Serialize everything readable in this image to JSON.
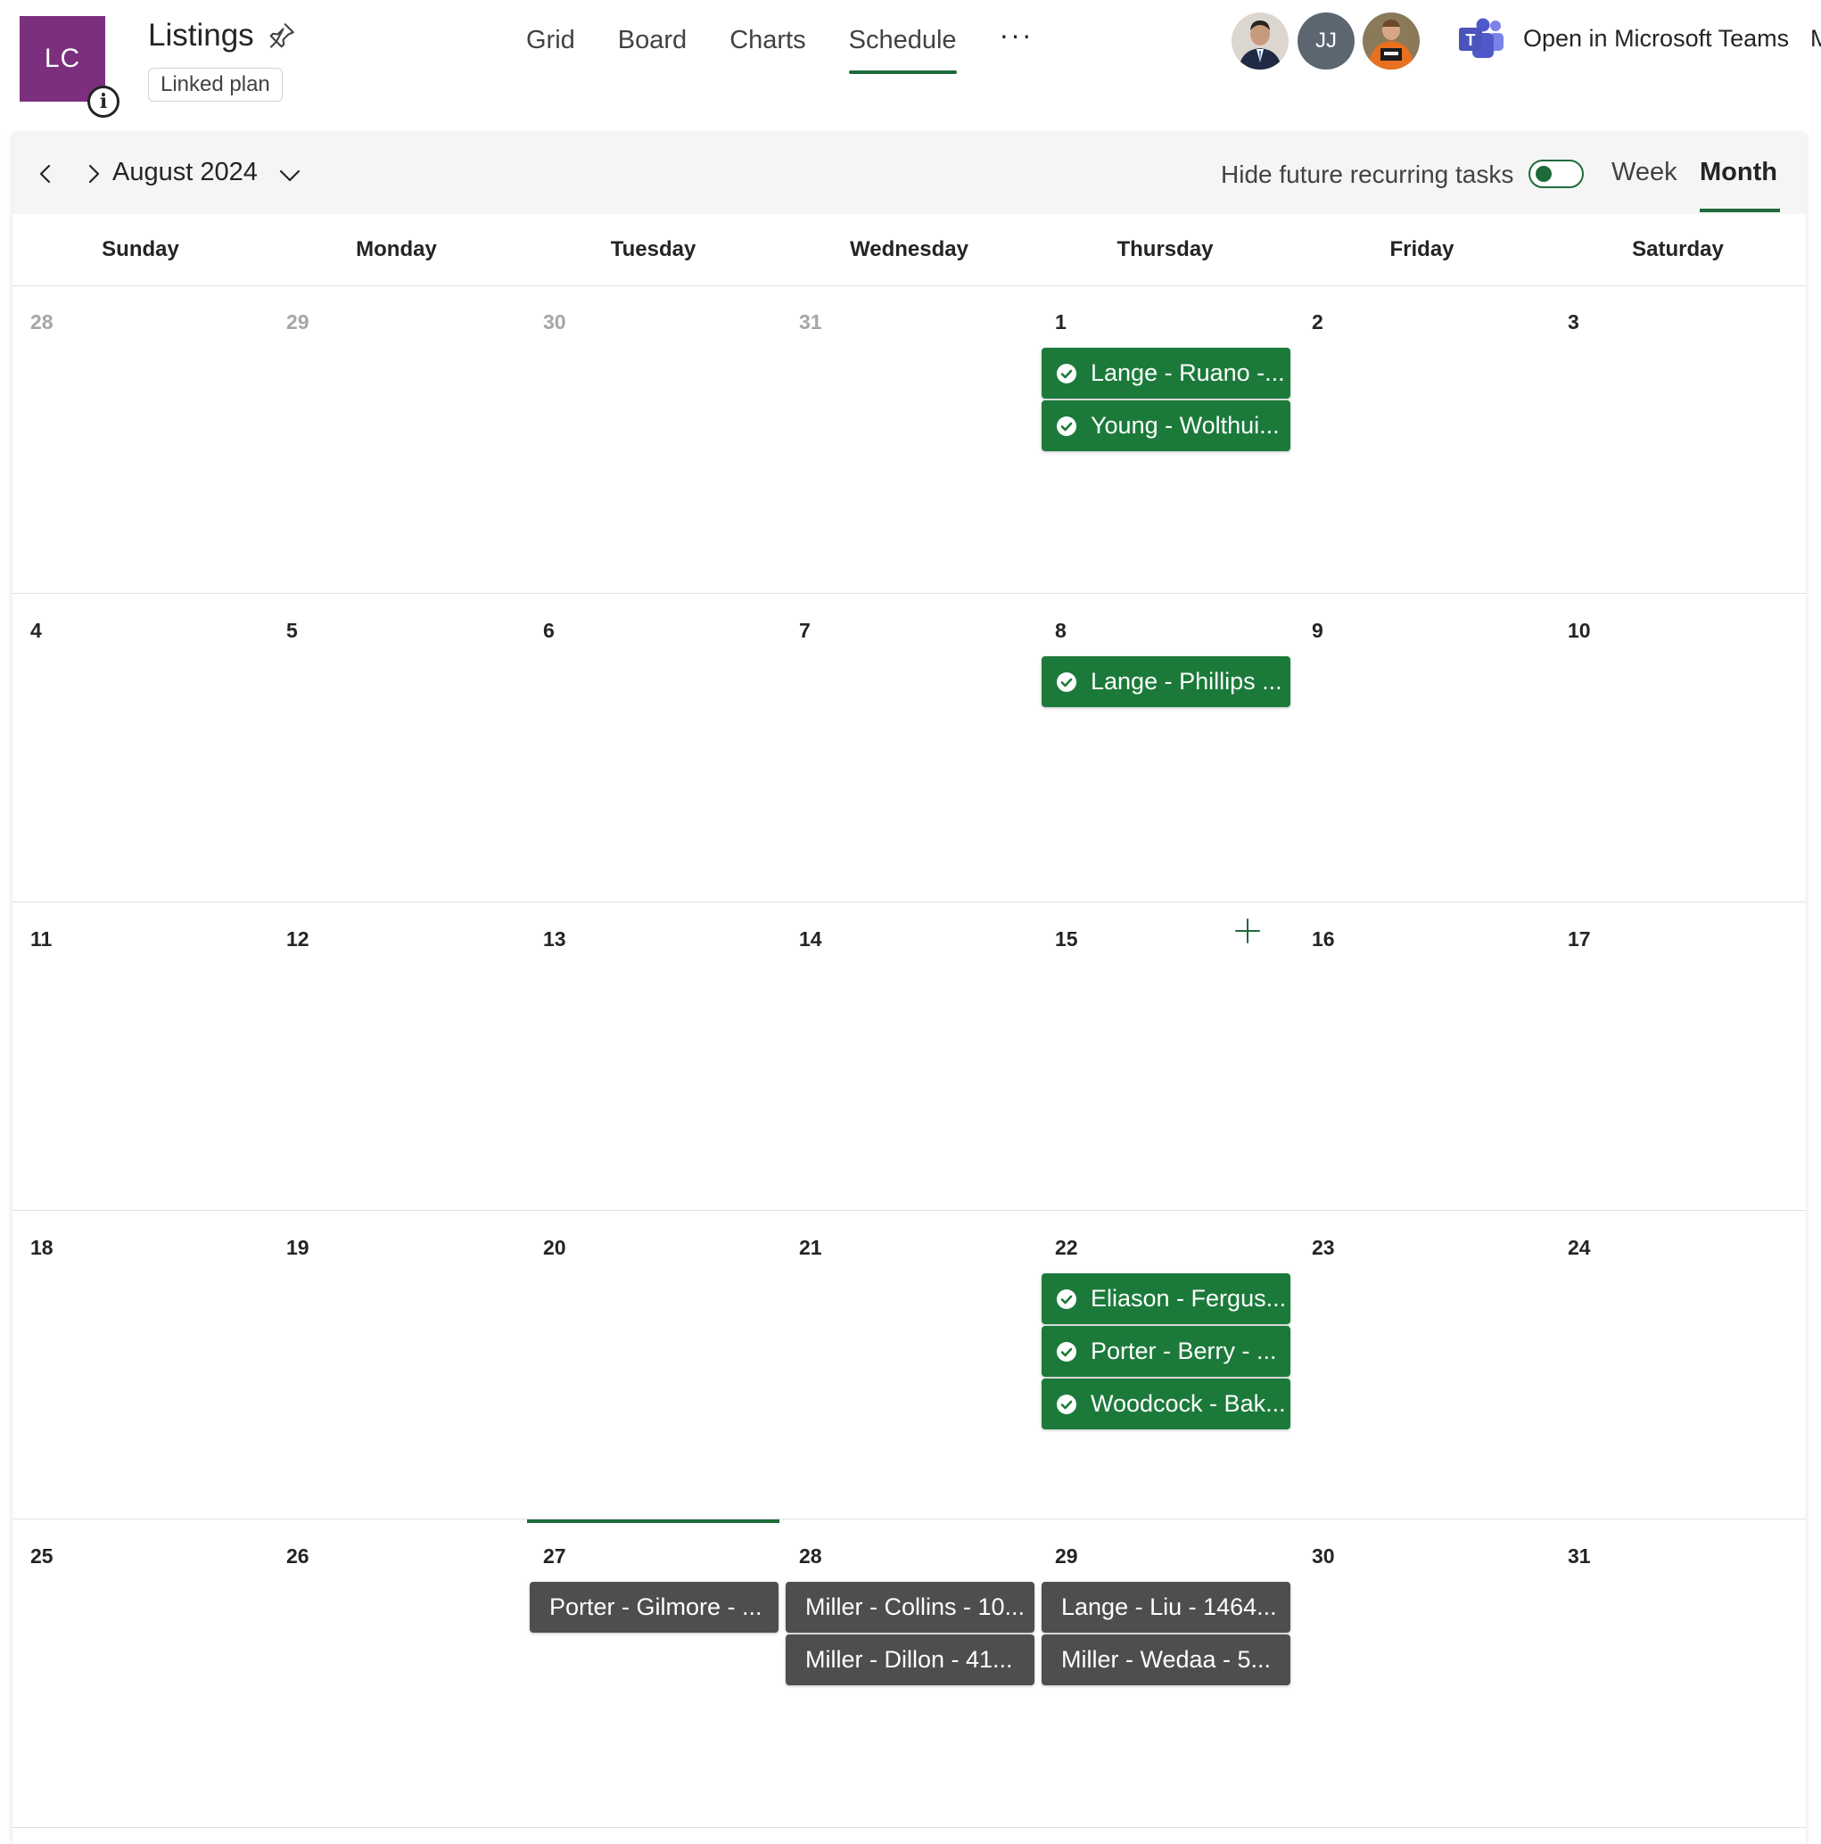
{
  "header": {
    "plan_initials": "LC",
    "plan_title": "Listings",
    "linked_plan": "Linked plan",
    "tabs": [
      {
        "label": "Grid"
      },
      {
        "label": "Board"
      },
      {
        "label": "Charts"
      },
      {
        "label": "Schedule"
      }
    ],
    "active_tab": "Schedule",
    "more": "···",
    "avatars": [
      {
        "kind": "photo"
      },
      {
        "initials": "JJ"
      },
      {
        "kind": "photo"
      }
    ],
    "open_in_teams": "Open in Microsoft Teams",
    "overflow_char": "M"
  },
  "calendar": {
    "month_label": "August 2024",
    "hide_recurring_label": "Hide future recurring tasks",
    "hide_recurring_on": true,
    "views": {
      "week": "Week",
      "month": "Month",
      "selected": "Month"
    },
    "weekdays": [
      "Sunday",
      "Monday",
      "Tuesday",
      "Wednesday",
      "Thursday",
      "Friday",
      "Saturday"
    ],
    "weeks": [
      [
        {
          "day": "28",
          "other_month": true
        },
        {
          "day": "29",
          "other_month": true
        },
        {
          "day": "30",
          "other_month": true
        },
        {
          "day": "31",
          "other_month": true
        },
        {
          "day": "1",
          "tasks": [
            {
              "title": "Lange - Ruano -...",
              "status": "done"
            },
            {
              "title": "Young - Wolthui...",
              "status": "done"
            }
          ]
        },
        {
          "day": "2"
        },
        {
          "day": "3"
        }
      ],
      [
        {
          "day": "4"
        },
        {
          "day": "5"
        },
        {
          "day": "6"
        },
        {
          "day": "7"
        },
        {
          "day": "8",
          "tasks": [
            {
              "title": "Lange - Phillips ...",
              "status": "done"
            }
          ]
        },
        {
          "day": "9"
        },
        {
          "day": "10"
        }
      ],
      [
        {
          "day": "11"
        },
        {
          "day": "12"
        },
        {
          "day": "13"
        },
        {
          "day": "14"
        },
        {
          "day": "15",
          "add_button": true
        },
        {
          "day": "16"
        },
        {
          "day": "17"
        }
      ],
      [
        {
          "day": "18"
        },
        {
          "day": "19"
        },
        {
          "day": "20"
        },
        {
          "day": "21"
        },
        {
          "day": "22",
          "tasks": [
            {
              "title": "Eliason - Fergus...",
              "status": "done"
            },
            {
              "title": "Porter - Berry - ...",
              "status": "done"
            },
            {
              "title": "Woodcock - Bak...",
              "status": "done"
            }
          ]
        },
        {
          "day": "23"
        },
        {
          "day": "24"
        }
      ],
      [
        {
          "day": "25"
        },
        {
          "day": "26"
        },
        {
          "day": "27",
          "today": true,
          "tasks": [
            {
              "title": "Porter - Gilmore - ...",
              "status": "pending"
            }
          ]
        },
        {
          "day": "28",
          "tasks": [
            {
              "title": "Miller - Collins - 10...",
              "status": "pending"
            },
            {
              "title": "Miller - Dillon - 41...",
              "status": "pending"
            }
          ]
        },
        {
          "day": "29",
          "tasks": [
            {
              "title": "Lange - Liu - 1464...",
              "status": "pending"
            },
            {
              "title": "Miller - Wedaa - 5...",
              "status": "pending"
            }
          ]
        },
        {
          "day": "30"
        },
        {
          "day": "31"
        }
      ]
    ]
  },
  "colors": {
    "brand_green": "#1e6b3a",
    "task_done": "#1b7a3a",
    "task_pending": "#4e4e4e",
    "plan_tile": "#7b2f7d"
  }
}
